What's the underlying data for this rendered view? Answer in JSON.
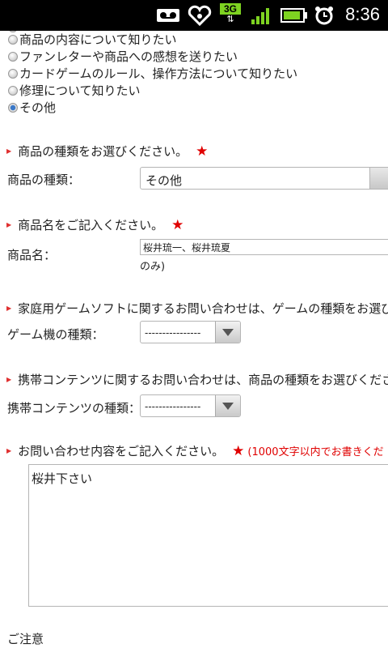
{
  "status_bar": {
    "time": "8:36",
    "network": "3G",
    "icons": [
      "voicemail-icon",
      "heart-icon",
      "network-3g-icon",
      "signal-icon",
      "battery-icon",
      "alarm-icon"
    ]
  },
  "inquiry_type": {
    "options": [
      {
        "label": "商品の内容について知りたい",
        "checked": false
      },
      {
        "label": "ファンレターや商品への感想を送りたい",
        "checked": false
      },
      {
        "label": "カードゲームのルール、操作方法について知りたい",
        "checked": false
      },
      {
        "label": "修理について知りたい",
        "checked": false
      },
      {
        "label": "その他",
        "checked": true
      }
    ]
  },
  "product_type": {
    "heading": "商品の種類をお選びください。",
    "label": "商品の種類：",
    "value": "その他"
  },
  "product_name": {
    "heading": "商品名をご記入ください。",
    "label": "商品名：",
    "value": "桜井琉一、桜井琉夏",
    "hint": "のみ)"
  },
  "game_machine": {
    "heading": "家庭用ゲームソフトに関するお問い合わせは、ゲームの種類をお選び",
    "label": "ゲーム機の種類：",
    "value": "----------------"
  },
  "mobile_content": {
    "heading": "携帯コンテンツに関するお問い合わせは、商品の種類をお選びくださ",
    "label": "携帯コンテンツの種類：",
    "value": "----------------"
  },
  "inquiry_content": {
    "heading": "お問い合わせ内容をご記入ください。",
    "note": "(1000文字以内でお書きくだ",
    "value": "桜井下さい"
  },
  "notice": {
    "label": "ご注意"
  },
  "required_mark": "★",
  "colors": {
    "required": "#e00000",
    "accent": "#3a78c8"
  }
}
